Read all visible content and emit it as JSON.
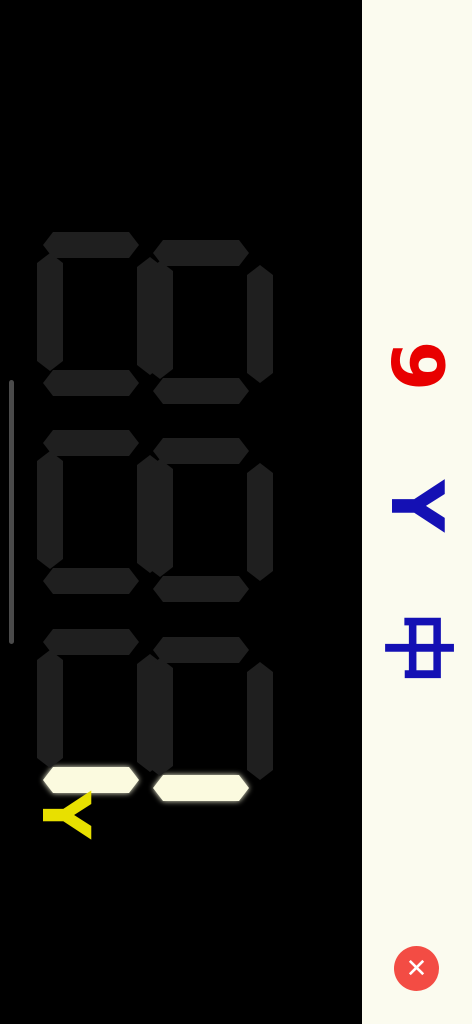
{
  "panel": {
    "chars": [
      {
        "text": "9",
        "color": "#e80000"
      },
      {
        "text": "Y",
        "color": "#1410b4"
      },
      {
        "text": "中",
        "color": "#1410b4"
      }
    ]
  },
  "display": {
    "lit_color": "#fbfadf",
    "unlit_color": "#1f1f1f",
    "lit_segments": [
      "row3-left-bottom",
      "row3-right-bottom"
    ]
  },
  "badge": {
    "text": "Y",
    "color": "#e8e000"
  },
  "close": {
    "icon": "close-icon",
    "glyph": "✕",
    "color": "#f34c44"
  }
}
